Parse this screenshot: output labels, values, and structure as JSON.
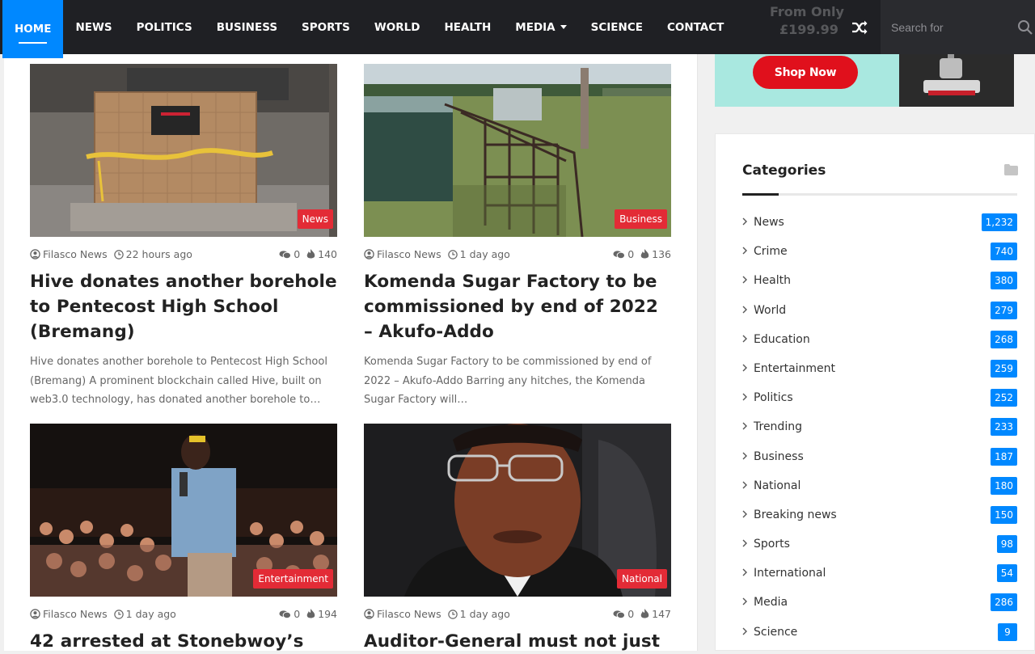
{
  "nav": {
    "items": [
      {
        "label": "HOME"
      },
      {
        "label": "NEWS"
      },
      {
        "label": "POLITICS"
      },
      {
        "label": "BUSINESS"
      },
      {
        "label": "SPORTS"
      },
      {
        "label": "WORLD"
      },
      {
        "label": "HEALTH"
      },
      {
        "label": "MEDIA"
      },
      {
        "label": "SCIENCE"
      },
      {
        "label": "CONTACT"
      }
    ],
    "active_index": 0,
    "search_placeholder": "Search for"
  },
  "ad": {
    "faded_text_1": "From Only",
    "faded_text_2": "£199.99",
    "button_label": "Shop Now"
  },
  "posts": [
    {
      "category": "News",
      "author": "Filasco News",
      "time": "22 hours ago",
      "comments": "0",
      "views": "140",
      "title": "Hive donates another borehole to Pentecost High School (Bremang)",
      "excerpt": "Hive donates another borehole to Pentecost High School (Bremang) A prominent blockchain called Hive, built on web3.0 technology, has donated another borehole to…"
    },
    {
      "category": "Business",
      "author": "Filasco News",
      "time": "1 day ago",
      "comments": "0",
      "views": "136",
      "title": "Komenda Sugar Factory to be commissioned by end of 2022 – Akufo-Addo",
      "excerpt": "Komenda Sugar Factory to be commissioned by end of 2022 – Akufo-Addo Barring any hitches, the Komenda Sugar Factory will…"
    },
    {
      "category": "Entertainment",
      "author": "Filasco News",
      "time": "1 day ago",
      "comments": "0",
      "views": "194",
      "title": "42 arrested at Stonebwoy’s",
      "excerpt": ""
    },
    {
      "category": "National",
      "author": "Filasco News",
      "time": "1 day ago",
      "comments": "0",
      "views": "147",
      "title": "Auditor-General must not just",
      "excerpt": ""
    }
  ],
  "categories": {
    "title": "Categories",
    "items": [
      {
        "label": "News",
        "count": "1,232"
      },
      {
        "label": "Crime",
        "count": "740"
      },
      {
        "label": "Health",
        "count": "380"
      },
      {
        "label": "World",
        "count": "279"
      },
      {
        "label": "Education",
        "count": "268"
      },
      {
        "label": "Entertainment",
        "count": "259"
      },
      {
        "label": "Politics",
        "count": "252"
      },
      {
        "label": "Trending",
        "count": "233"
      },
      {
        "label": "Business",
        "count": "187"
      },
      {
        "label": "National",
        "count": "180"
      },
      {
        "label": "Breaking news",
        "count": "150"
      },
      {
        "label": "Sports",
        "count": "98"
      },
      {
        "label": "International",
        "count": "54"
      },
      {
        "label": "Media",
        "count": "286"
      },
      {
        "label": "Science",
        "count": "9"
      }
    ]
  },
  "colors": {
    "accent": "#0088ff",
    "badge": "#e32b36",
    "nav_bg": "#1f2024"
  }
}
